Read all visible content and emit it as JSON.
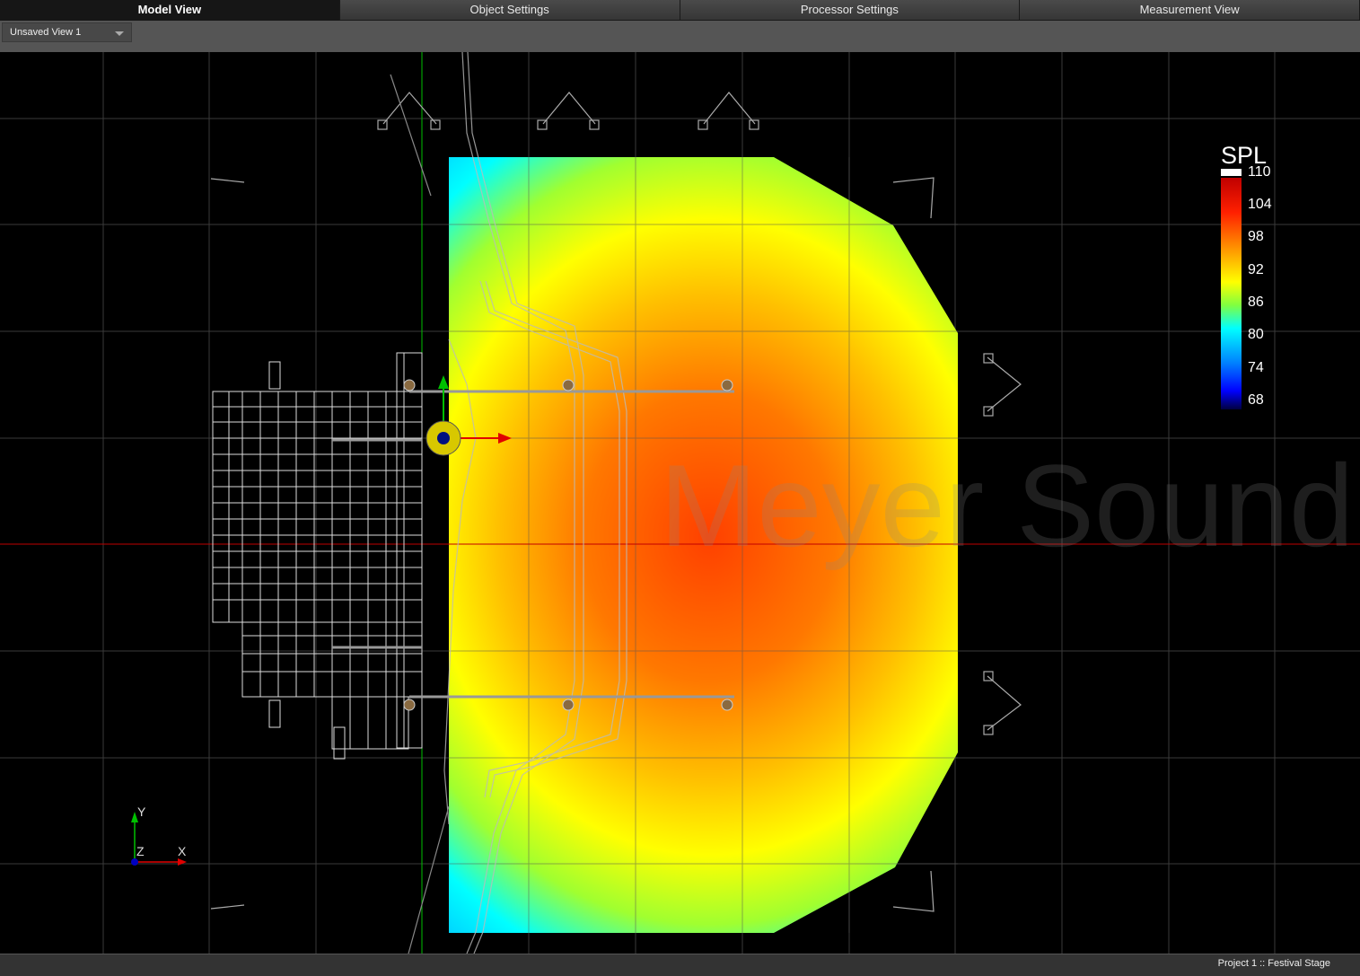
{
  "tabs": [
    {
      "label": "Model View",
      "active": true
    },
    {
      "label": "Object Settings",
      "active": false
    },
    {
      "label": "Processor Settings",
      "active": false
    },
    {
      "label": "Measurement View",
      "active": false
    }
  ],
  "view_selector": {
    "value": "Unsaved View 1",
    "icon": "chevron-down-icon"
  },
  "legend": {
    "title": "SPL",
    "levels": [
      "110",
      "104",
      "98",
      "92",
      "86",
      "80",
      "74",
      "68"
    ]
  },
  "axes": {
    "y": "Y",
    "z": "Z",
    "x": "X"
  },
  "status": {
    "text": "Project 1 :: Festival Stage"
  },
  "colors": {
    "grid": "#3a3a3a",
    "x_axis": "#c00000",
    "y_axis": "#00c000"
  },
  "watermark": "Meyer Sound"
}
